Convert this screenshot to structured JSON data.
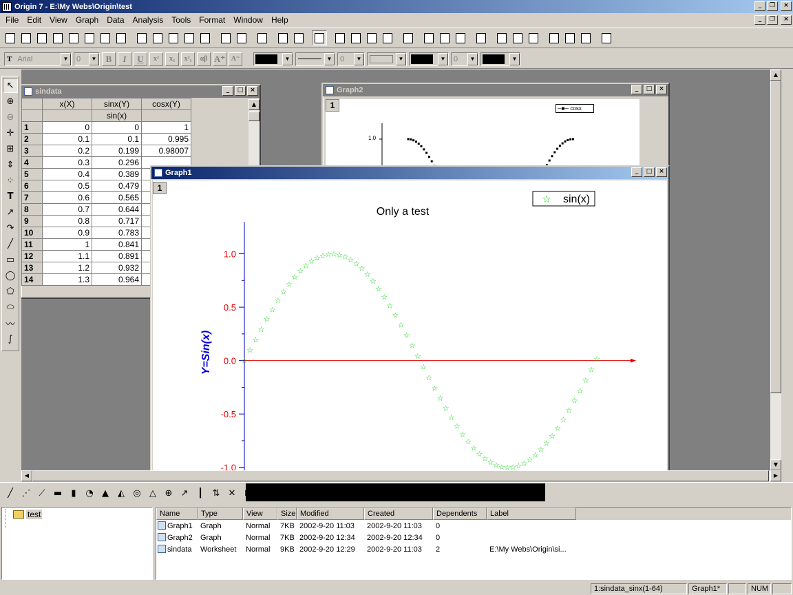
{
  "app": {
    "title": "Origin 7 - E:\\My Webs\\Origin\\test"
  },
  "menu": [
    "File",
    "Edit",
    "View",
    "Graph",
    "Data",
    "Analysis",
    "Tools",
    "Format",
    "Window",
    "Help"
  ],
  "format_bar": {
    "font": "Arial",
    "size": "0",
    "line_width": "0",
    "symbol_size": "0"
  },
  "worksheet": {
    "title": "sindata",
    "columns": [
      "x(X)",
      "sinx(Y)",
      "cosx(Y)"
    ],
    "column_label_row": [
      "",
      "sin(x)",
      ""
    ],
    "rows": [
      [
        "1",
        "0",
        "0",
        "1"
      ],
      [
        "2",
        "0.1",
        "0.1",
        "0.995"
      ],
      [
        "3",
        "0.2",
        "0.199",
        "0.98007"
      ],
      [
        "4",
        "0.3",
        "0.296",
        ""
      ],
      [
        "5",
        "0.4",
        "0.389",
        ""
      ],
      [
        "6",
        "0.5",
        "0.479",
        ""
      ],
      [
        "7",
        "0.6",
        "0.565",
        ""
      ],
      [
        "8",
        "0.7",
        "0.644",
        ""
      ],
      [
        "9",
        "0.8",
        "0.717",
        ""
      ],
      [
        "10",
        "0.9",
        "0.783",
        ""
      ],
      [
        "11",
        "1",
        "0.841",
        ""
      ],
      [
        "12",
        "1.1",
        "0.891",
        ""
      ],
      [
        "13",
        "1.2",
        "0.932",
        ""
      ],
      [
        "14",
        "1.3",
        "0.964",
        ""
      ]
    ]
  },
  "graph2": {
    "title": "Graph2",
    "layer": "1",
    "legend": "cosx",
    "tick_label": "1.0"
  },
  "graph1": {
    "title": "Graph1",
    "layer": "1",
    "chart_data": {
      "type": "scatter",
      "title": "Only a test",
      "ylabel": "Y=Sin(x)",
      "xlabel": "",
      "legend": "sin(x)",
      "legend_position": "top-right",
      "series": [
        {
          "name": "sin(x)",
          "x_start": 0,
          "x_step": 0.1,
          "count": 64,
          "function": "sin"
        }
      ],
      "xlim": [
        0,
        7
      ],
      "ylim": [
        -1.15,
        1.3
      ],
      "yticks": [
        "1.0",
        "0.5",
        "0.0",
        "-0.5",
        "-1.0"
      ],
      "marker": "star",
      "marker_color": "#00cc00"
    }
  },
  "explorer": {
    "folder": "test",
    "columns": [
      "Name",
      "Type",
      "View",
      "Size",
      "Modified",
      "Created",
      "Dependents",
      "Label"
    ],
    "rows": [
      {
        "icon": "graph-file-icon",
        "cells": [
          "Graph1",
          "Graph",
          "Normal",
          "7KB",
          "2002-9-20 11:03",
          "2002-9-20 11:03",
          "0",
          ""
        ]
      },
      {
        "icon": "graph-file-icon",
        "cells": [
          "Graph2",
          "Graph",
          "Normal",
          "7KB",
          "2002-9-20 12:34",
          "2002-9-20 12:34",
          "0",
          ""
        ]
      },
      {
        "icon": "worksheet-file-icon",
        "cells": [
          "sindata",
          "Worksheet",
          "Normal",
          "9KB",
          "2002-9-20 12:29",
          "2002-9-20 11:03",
          "2",
          "E:\\My Webs\\Origin\\si..."
        ]
      }
    ]
  },
  "status": {
    "range": "1:sindata_sinx(1-64)",
    "window": "Graph1*",
    "num": "NUM"
  }
}
